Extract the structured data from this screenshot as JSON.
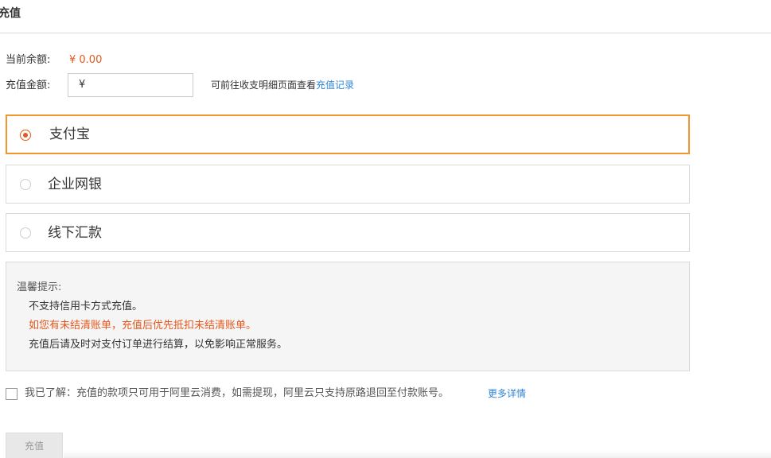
{
  "header": {
    "title": "充值"
  },
  "balance": {
    "label": "当前余额:",
    "value": "¥ 0.00"
  },
  "amount": {
    "label": "充值金额:",
    "prefix": "¥",
    "value": "",
    "placeholder": ""
  },
  "record_hint": {
    "text": "可前往收支明细页面查看",
    "link": "充值记录"
  },
  "payment_methods": [
    {
      "label": "支付宝",
      "selected": true
    },
    {
      "label": "企业网银",
      "selected": false
    },
    {
      "label": "线下汇款",
      "selected": false
    }
  ],
  "tips": {
    "title": "温馨提示:",
    "lines": [
      "不支持信用卡方式充值。",
      "如您有未结清账单，充值后优先抵扣未结清账单。",
      "充值后请及时对支付订单进行结算，以免影响正常服务。"
    ]
  },
  "agreement": {
    "checked": false,
    "text": "我已了解：充值的款项只可用于阿里云消费，如需提现，阿里云只支持原路退回至付款账号。",
    "more_link": "更多详情"
  },
  "submit": {
    "label": "充值",
    "enabled": false
  },
  "colors": {
    "accent": "#e4581e",
    "selected_border": "#f0962c",
    "link": "#2f84d6",
    "tips_background": "#f5f5f5"
  }
}
